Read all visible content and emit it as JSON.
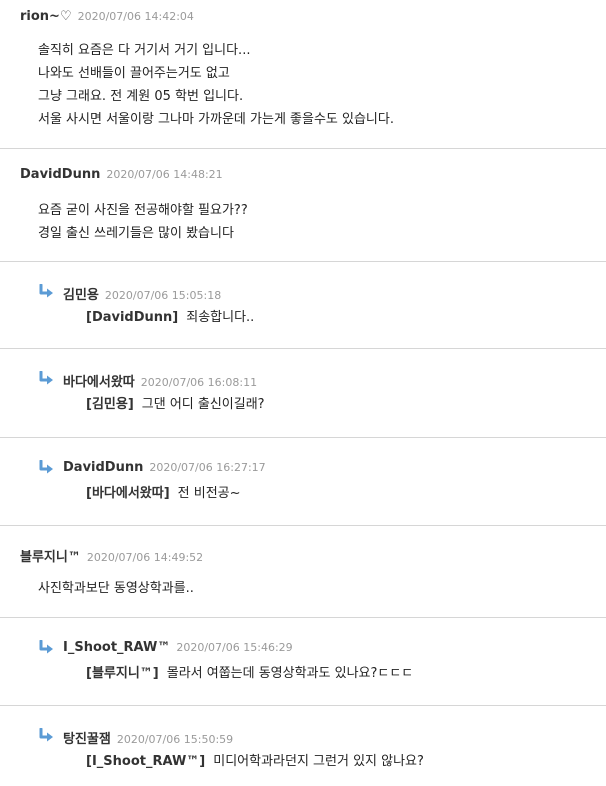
{
  "comments": [
    {
      "author": "rion~♡",
      "date": "2020/07/06 14:42:04",
      "lines": [
        "솔직히 요즘은 다 거기서 거기 입니다...",
        "나와도 선배들이 끌어주는거도 없고",
        "그냥 그래요. 전 계원 05 학번 입니다.",
        "서울 사시면 서울이랑 그나마 가까운데 가는게 좋을수도 있습니다."
      ]
    },
    {
      "author": "DavidDunn",
      "date": "2020/07/06 14:48:21",
      "lines": [
        "요즘 굳이 사진을 전공해야할 필요가??",
        "경일 출신 쓰레기들은 많이 봤습니다"
      ]
    },
    {
      "author": "김민용",
      "date": "2020/07/06 15:05:18",
      "mention": "[DavidDunn]",
      "text": "죄송합니다.."
    },
    {
      "author": "바다에서왔따",
      "date": "2020/07/06 16:08:11",
      "mention": "[김민용]",
      "text": "그댄 어디 출신이길래?"
    },
    {
      "author": "DavidDunn",
      "date": "2020/07/06 16:27:17",
      "mention": "[바다에서왔따]",
      "text": "전 비전공~"
    },
    {
      "author": "블루지니™",
      "date": "2020/07/06 14:49:52",
      "lines": [
        "사진학과보단 동영상학과를.."
      ]
    },
    {
      "author": "I_Shoot_RAW™",
      "date": "2020/07/06 15:46:29",
      "mention": "[블루지니™]",
      "text": "몰라서 여쭙는데 동영상학과도 있나요?ㄷㄷㄷ"
    },
    {
      "author": "탕진꿀잼",
      "date": "2020/07/06 15:50:59",
      "mention": "[I_Shoot_RAW™]",
      "text": "미디어학과라던지 그런거 있지 않나요?"
    }
  ],
  "icons": {
    "reply_arrow": "reply-arrow-icon",
    "reply_arrow_color": "#5b9bd5"
  }
}
